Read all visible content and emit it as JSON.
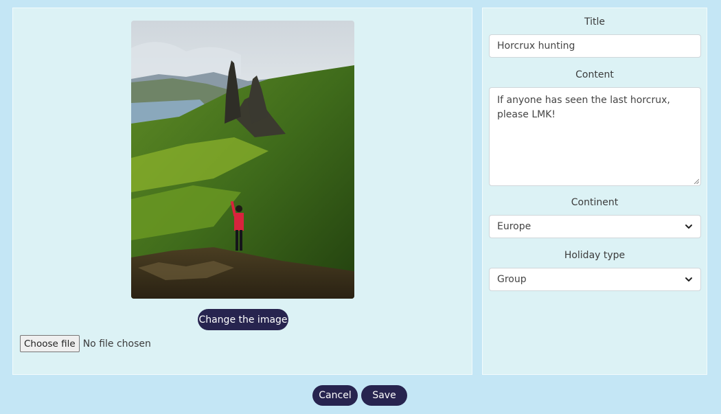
{
  "image_panel": {
    "change_image_label": "Change the image",
    "file_input": {
      "button_label": "Choose file",
      "status_text": "No file chosen"
    }
  },
  "form": {
    "title": {
      "label": "Title",
      "value": "Horcrux hunting"
    },
    "content": {
      "label": "Content",
      "value": "If anyone has seen the last horcrux, please LMK!"
    },
    "continent": {
      "label": "Continent",
      "selected": "Europe"
    },
    "holiday_type": {
      "label": "Holiday type",
      "selected": "Group"
    }
  },
  "actions": {
    "cancel_label": "Cancel",
    "save_label": "Save"
  },
  "colors": {
    "page_background": "#c4e6f5",
    "panel_background": "#dcf2f5",
    "button_background": "#27244f",
    "button_text": "#ffffff"
  }
}
